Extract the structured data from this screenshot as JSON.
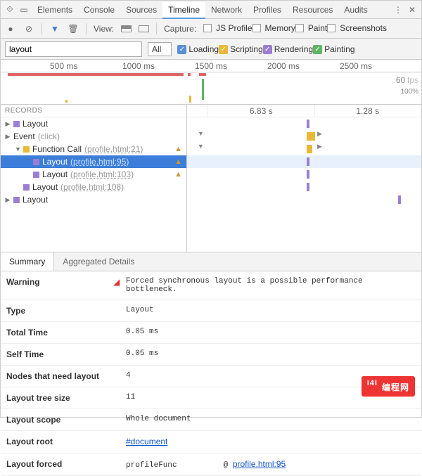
{
  "tabs": {
    "items": [
      "Elements",
      "Console",
      "Sources",
      "Timeline",
      "Network",
      "Profiles",
      "Resources",
      "Audits"
    ],
    "active": 3
  },
  "toolbar": {
    "view": "View:",
    "capture": "Capture:",
    "opts": [
      "JS Profile",
      "Memory",
      "Paint",
      "Screenshots"
    ]
  },
  "filter": {
    "value": "layout",
    "all": "All",
    "pills": [
      {
        "label": "Loading",
        "cls": "c-blue"
      },
      {
        "label": "Scripting",
        "cls": "c-yellow"
      },
      {
        "label": "Rendering",
        "cls": "c-purple"
      },
      {
        "label": "Painting",
        "cls": "c-green"
      }
    ]
  },
  "ruler": [
    "500 ms",
    "1000 ms",
    "1500 ms",
    "2000 ms",
    "2500 ms"
  ],
  "fps": {
    "a": "60",
    "b": "fps",
    "c": "100%"
  },
  "trackhead": [
    "",
    "6.83 s",
    "1.28 s"
  ],
  "rechead": "RECORDS",
  "records": [
    {
      "ind": 0,
      "tri": "▶",
      "sq": "sq-purple",
      "label": "Layout"
    },
    {
      "ind": 0,
      "tri": "▶",
      "sq": "",
      "label": "Event",
      "sub": "(click)"
    },
    {
      "ind": 1,
      "tri": "▼",
      "sq": "sq-yellow",
      "label": "Function Call",
      "link": "(profile.html:21)",
      "warn": true
    },
    {
      "ind": 2,
      "tri": "",
      "sq": "sq-purple",
      "label": "Layout",
      "link": "(profile.html:95)",
      "warn": true,
      "sel": true
    },
    {
      "ind": 2,
      "tri": "",
      "sq": "sq-purple",
      "label": "Layout",
      "link": "(profile.html:103)",
      "warn": true
    },
    {
      "ind": 1,
      "tri": "",
      "sq": "sq-purple",
      "label": "Layout",
      "link": "(profile.html:108)"
    },
    {
      "ind": 0,
      "tri": "▶",
      "sq": "sq-purple",
      "label": "Layout"
    }
  ],
  "dettabs": [
    "Summary",
    "Aggregated Details"
  ],
  "details": [
    {
      "k": "Warning",
      "v": "Forced synchronous layout is a possible performance bottleneck.",
      "flag": true
    },
    {
      "k": "Type",
      "v": "Layout"
    },
    {
      "k": "Total Time",
      "v": "0.05 ms"
    },
    {
      "k": "Self Time",
      "v": "0.05 ms"
    },
    {
      "k": "Nodes that need layout",
      "v": "4"
    },
    {
      "k": "Layout tree size",
      "v": "11"
    },
    {
      "k": "Layout scope",
      "v": "Whole document"
    },
    {
      "k": "Layout root",
      "v": "#document",
      "link": true
    },
    {
      "k": "Layout forced",
      "v": "profileFunc",
      "extra": "@ profile.html:95"
    }
  ],
  "watermark": "编程网"
}
